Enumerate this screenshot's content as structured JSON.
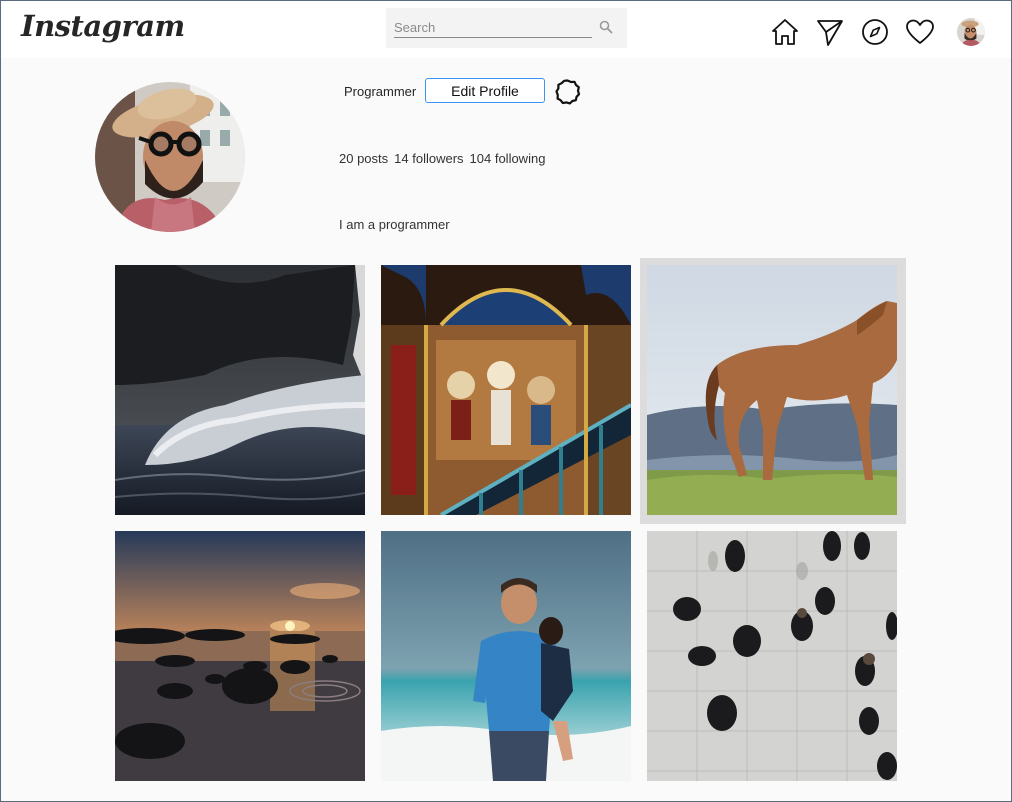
{
  "header": {
    "logo_text": "Instagram",
    "search_placeholder": "Search",
    "nav_icons": [
      "home-icon",
      "direct-message-icon",
      "explore-compass-icon",
      "activity-heart-icon",
      "profile-avatar"
    ]
  },
  "profile": {
    "username": "Programmer",
    "edit_label": "Edit Profile",
    "stats": {
      "posts": "20 posts",
      "followers": "14 followers",
      "following": "104 following"
    },
    "bio": "I am a programmer"
  },
  "posts": [
    {
      "subject": "ocean wave"
    },
    {
      "subject": "cathedral mosaic"
    },
    {
      "subject": "horse in field"
    },
    {
      "subject": "sunset over rocky shore"
    },
    {
      "subject": "father holding child at beach"
    },
    {
      "subject": "crowd walking from above"
    }
  ],
  "colors": {
    "accent": "#3797f0",
    "background": "#fafafa",
    "text": "#262626"
  }
}
